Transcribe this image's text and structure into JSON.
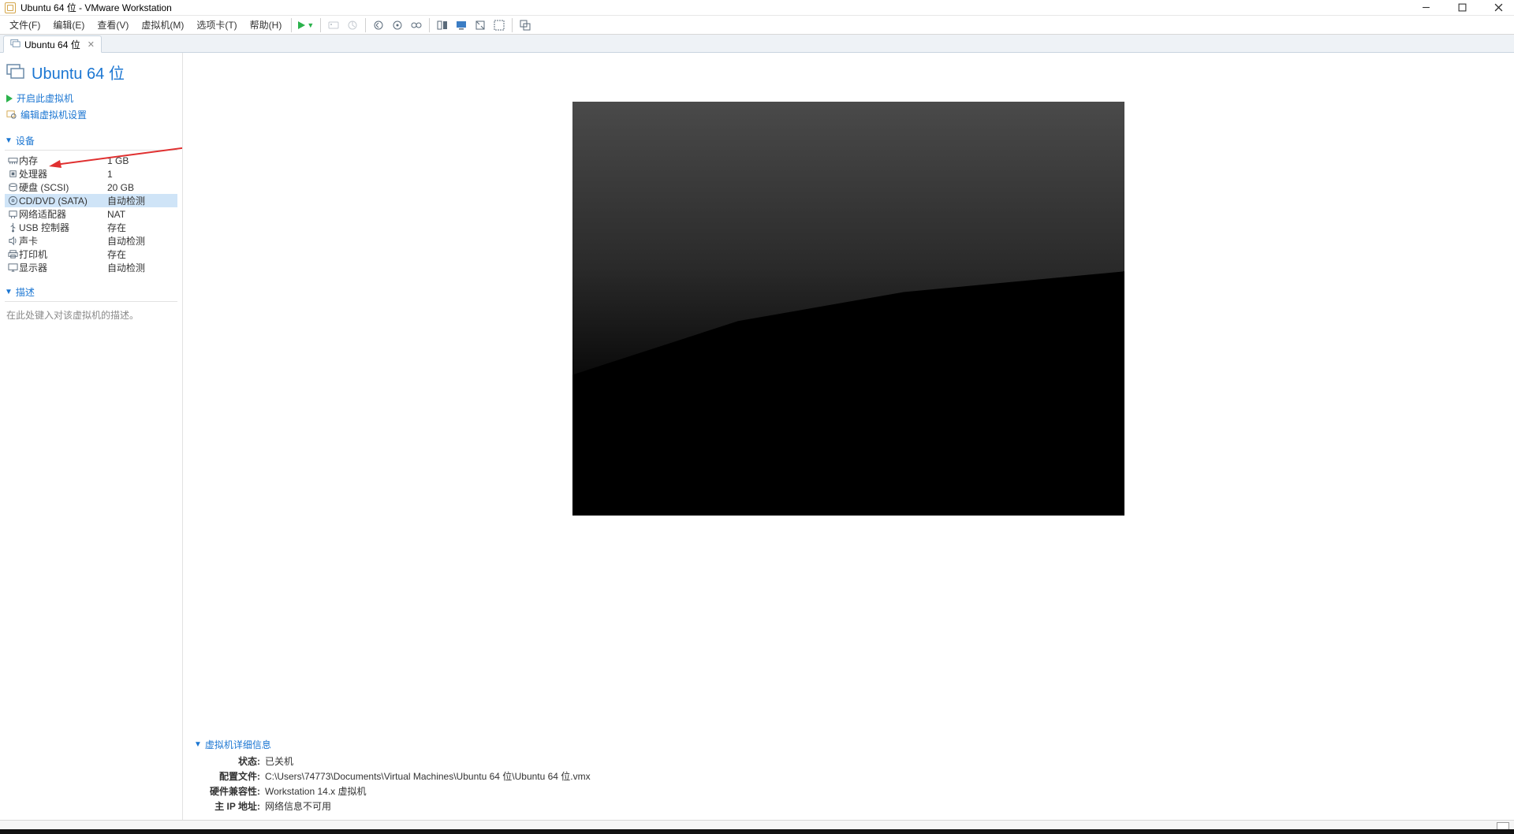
{
  "window": {
    "title": "Ubuntu 64 位 - VMware Workstation"
  },
  "menu": {
    "file": "文件(F)",
    "edit": "编辑(E)",
    "view": "查看(V)",
    "vm": "虚拟机(M)",
    "tabs": "选项卡(T)",
    "help": "帮助(H)"
  },
  "tab": {
    "label": "Ubuntu 64 位"
  },
  "sidebar": {
    "vm_title": "Ubuntu 64 位",
    "action_power_on": "开启此虚拟机",
    "action_edit_settings": "编辑虚拟机设置",
    "devices_header": "设备",
    "devices": [
      {
        "name": "内存",
        "value": "1 GB",
        "icon": "memory"
      },
      {
        "name": "处理器",
        "value": "1",
        "icon": "cpu"
      },
      {
        "name": "硬盘 (SCSI)",
        "value": "20 GB",
        "icon": "disk"
      },
      {
        "name": "CD/DVD (SATA)",
        "value": "自动检测",
        "icon": "cd",
        "selected": true
      },
      {
        "name": "网络适配器",
        "value": "NAT",
        "icon": "net"
      },
      {
        "name": "USB 控制器",
        "value": "存在",
        "icon": "usb"
      },
      {
        "name": "声卡",
        "value": "自动检测",
        "icon": "sound"
      },
      {
        "name": "打印机",
        "value": "存在",
        "icon": "printer"
      },
      {
        "name": "显示器",
        "value": "自动检测",
        "icon": "display"
      }
    ],
    "description_header": "描述",
    "description_placeholder": "在此处键入对该虚拟机的描述。"
  },
  "details": {
    "header": "虚拟机详细信息",
    "lines": [
      {
        "k": "状态:",
        "v": "已关机"
      },
      {
        "k": "配置文件:",
        "v": "C:\\Users\\74773\\Documents\\Virtual Machines\\Ubuntu 64 位\\Ubuntu 64 位.vmx"
      },
      {
        "k": "硬件兼容性:",
        "v": "Workstation 14.x 虚拟机"
      },
      {
        "k": "主 IP 地址:",
        "v": "网络信息不可用"
      }
    ]
  }
}
